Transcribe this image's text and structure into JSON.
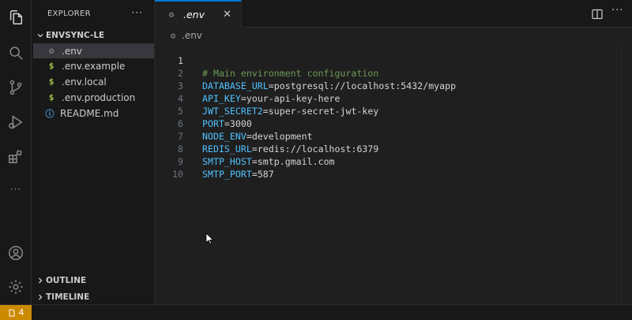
{
  "sidebar": {
    "title": "EXPLORER",
    "more": "···",
    "folder": "ENVSYNC-LE",
    "files": [
      {
        "label": ".env",
        "icon": "gear-icon",
        "glyph": "⚙"
      },
      {
        "label": ".env.example",
        "icon": "dollar-icon",
        "glyph": "$"
      },
      {
        "label": ".env.local",
        "icon": "dollar-icon",
        "glyph": "$"
      },
      {
        "label": ".env.production",
        "icon": "dollar-icon",
        "glyph": "$"
      },
      {
        "label": "README.md",
        "icon": "info-icon",
        "glyph": "ⓘ"
      }
    ],
    "sections": {
      "outline": "OUTLINE",
      "timeline": "TIMELINE"
    }
  },
  "tab": {
    "label": ".env",
    "close": "✕",
    "glyph": "⚙"
  },
  "breadcrumb": {
    "label": ".env",
    "glyph": "⚙"
  },
  "editor": {
    "lines": [
      {
        "n": "1",
        "comment": "# Main environment configuration"
      },
      {
        "n": "2",
        "key": "DATABASE_URL",
        "value": "postgresql://localhost:5432/myapp"
      },
      {
        "n": "3",
        "key": "API_KEY",
        "value": "your-api-key-here"
      },
      {
        "n": "4",
        "key": "JWT_SECRET2",
        "value": "super-secret-jwt-key"
      },
      {
        "n": "5",
        "key": "PORT",
        "value": "3000"
      },
      {
        "n": "6",
        "key": "NODE_ENV",
        "value": "development"
      },
      {
        "n": "7",
        "key": "REDIS_URL",
        "value": "redis://localhost:6379"
      },
      {
        "n": "8",
        "key": "SMTP_HOST",
        "value": "smtp.gmail.com"
      },
      {
        "n": "9",
        "key": "SMTP_PORT",
        "value": "587"
      },
      {
        "n": "10"
      }
    ],
    "equals": "="
  },
  "header": {
    "more": "···"
  },
  "activity": {
    "more": "···"
  },
  "status": {
    "problems": "4"
  },
  "colors": {
    "accent": "#0078d4",
    "key": "#4fc1ff",
    "comment": "#6a9955",
    "warning": "#cc8a00"
  }
}
